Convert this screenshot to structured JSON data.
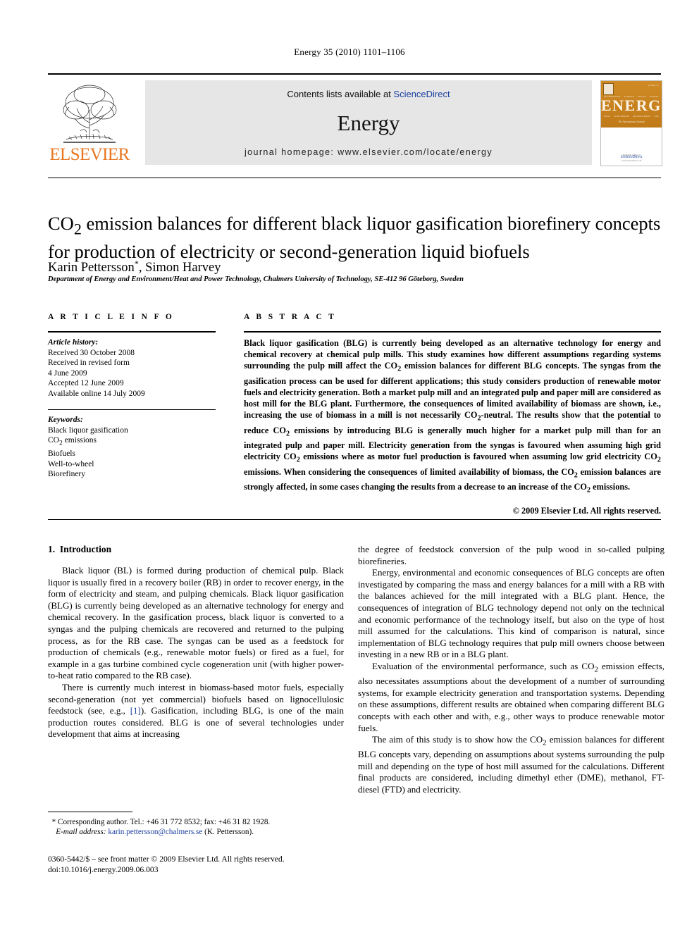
{
  "running_head": "Energy 35 (2010) 1101–1106",
  "masthead": {
    "contents_prefix": "Contents lists available at ",
    "sciencedirect": "ScienceDirect",
    "journal_name": "Energy",
    "homepage": "journal homepage: www.elsevier.com/locate/energy",
    "publisher_wordmark": "ELSEVIER",
    "publisher_logo_icon": "elsevier-tree-icon",
    "cover": {
      "title": "ENERGY",
      "issue_label": "Volume 35",
      "top_row": [
        "TECHNOLOGY",
        "SCIENCE",
        "POLICY",
        "SUPPLY"
      ],
      "bottom_row": [
        "HEAT",
        "CONVERSION",
        "MANAGEMENT",
        "USE"
      ],
      "subtitle": "The International Journal",
      "available_at": "Available online at",
      "sciencedirect": "ScienceDirect",
      "sciencedirect_url": "www.sciencedirect.com"
    }
  },
  "article": {
    "title": "CO2 emission balances for different black liquor gasification biorefinery concepts for production of electricity or second-generation liquid biofuels",
    "title_part1": "CO",
    "title_sub": "2",
    "title_part2": " emission balances for different black liquor gasification biorefinery concepts for production of electricity or second-generation liquid biofuels",
    "authors": "Karin Pettersson",
    "author_marker": "*",
    "authors_rest": ", Simon Harvey",
    "affiliation": "Department of Energy and Environment/Heat and Power Technology, Chalmers University of Technology, SE-412 96 Göteborg, Sweden"
  },
  "article_info": {
    "heading": "A R T I C L E   I N F O",
    "history_label": "Article history:",
    "history": [
      "Received 30 October 2008",
      "Received in revised form",
      "4 June 2009",
      "Accepted 12 June 2009",
      "Available online 14 July 2009"
    ],
    "keywords_label": "Keywords:",
    "keywords": [
      "Black liquor gasification",
      "CO2 emissions",
      "Biofuels",
      "Well-to-wheel",
      "Biorefinery"
    ]
  },
  "abstract": {
    "heading": "A B S T R A C T",
    "text": "Black liquor gasification (BLG) is currently being developed as an alternative technology for energy and chemical recovery at chemical pulp mills. This study examines how different assumptions regarding systems surrounding the pulp mill affect the CO2 emission balances for different BLG concepts. The syngas from the gasification process can be used for different applications; this study considers production of renewable motor fuels and electricity generation. Both a market pulp mill and an integrated pulp and paper mill are considered as host mill for the BLG plant. Furthermore, the consequences of limited availability of biomass are shown, i.e., increasing the use of biomass in a mill is not necessarily CO2-neutral. The results show that the potential to reduce CO2 emissions by introducing BLG is generally much higher for a market pulp mill than for an integrated pulp and paper mill. Electricity generation from the syngas is favoured when assuming high grid electricity CO2 emissions where as motor fuel production is favoured when assuming low grid electricity CO2 emissions. When considering the consequences of limited availability of biomass, the CO2 emission balances are strongly affected, in some cases changing the results from a decrease to an increase of the CO2 emissions.",
    "copyright": "© 2009 Elsevier Ltd. All rights reserved."
  },
  "body": {
    "section_number": "1.",
    "section_title": "Introduction",
    "left_paragraphs": [
      "Black liquor (BL) is formed during production of chemical pulp. Black liquor is usually fired in a recovery boiler (RB) in order to recover energy, in the form of electricity and steam, and pulping chemicals. Black liquor gasification (BLG) is currently being developed as an alternative technology for energy and chemical recovery. In the gasification process, black liquor is converted to a syngas and the pulping chemicals are recovered and returned to the pulping process, as for the RB case. The syngas can be used as a feedstock for production of chemicals (e.g., renewable motor fuels) or fired as a fuel, for example in a gas turbine combined cycle cogeneration unit (with higher power-to-heat ratio compared to the RB case).",
      "There is currently much interest in biomass-based motor fuels, especially second-generation (not yet commercial) biofuels based on lignocellulosic feedstock (see, e.g., [1]). Gasification, including BLG, is one of the main production routes considered. BLG is one of several technologies under development that aims at increasing"
    ],
    "left_paragraph2_pre": "There is currently much interest in biomass-based motor fuels, especially second-generation (not yet commercial) biofuels based on lignocellulosic feedstock (see, e.g., ",
    "left_paragraph2_cite": "[1]",
    "left_paragraph2_post": "). Gasification, including BLG, is one of the main production routes considered. BLG is one of several technologies under development that aims at increasing",
    "right_paragraphs": [
      "the degree of feedstock conversion of the pulp wood in so-called pulping biorefineries.",
      "Energy, environmental and economic consequences of BLG concepts are often investigated by comparing the mass and energy balances for a mill with a RB with the balances achieved for the mill integrated with a BLG plant. Hence, the consequences of integration of BLG technology depend not only on the technical and economic performance of the technology itself, but also on the type of host mill assumed for the calculations. This kind of comparison is natural, since implementation of BLG technology requires that pulp mill owners choose between investing in a new RB or in a BLG plant.",
      "Evaluation of the environmental performance, such as CO2 emission effects, also necessitates assumptions about the development of a number of surrounding systems, for example electricity generation and transportation systems. Depending on these assumptions, different results are obtained when comparing different BLG concepts with each other and with, e.g., other ways to produce renewable motor fuels.",
      "The aim of this study is to show how the CO2 emission balances for different BLG concepts vary, depending on assumptions about systems surrounding the pulp mill and depending on the type of host mill assumed for the calculations. Different final products are considered, including dimethyl ether (DME), methanol, FT-diesel (FTD) and electricity."
    ]
  },
  "footnote": {
    "marker": "*",
    "corresponding": "Corresponding author. Tel.: +46 31 772 8532; fax: +46 31 82 1928.",
    "email_label": "E-mail address:",
    "email": "karin.pettersson@chalmers.se",
    "email_suffix": "(K. Pettersson)."
  },
  "imprint": {
    "line1": "0360-5442/$ – see front matter © 2009 Elsevier Ltd. All rights reserved.",
    "line2": "doi:10.1016/j.energy.2009.06.003"
  }
}
